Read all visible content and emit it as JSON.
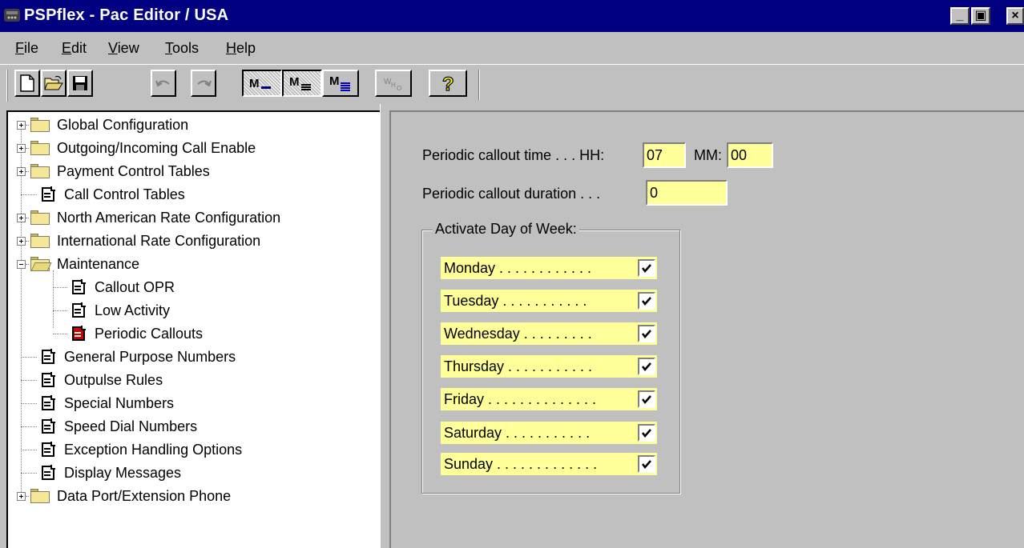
{
  "window": {
    "title": "PSPflex - Pac Editor / USA",
    "controls": {
      "minimize": "_",
      "maximize": "▣",
      "close": "×"
    }
  },
  "menu": {
    "items": [
      {
        "label": "File",
        "accel": "F",
        "rest": "ile"
      },
      {
        "label": "Edit",
        "accel": "E",
        "rest": "dit"
      },
      {
        "label": "View",
        "accel": "V",
        "rest": "iew"
      },
      {
        "label": "Tools",
        "accel": "T",
        "rest": "ools"
      },
      {
        "label": "Help",
        "accel": "H",
        "rest": "elp"
      }
    ]
  },
  "toolbar": {
    "buttons": [
      {
        "icon": "new-file-icon"
      },
      {
        "icon": "open-folder-icon"
      },
      {
        "icon": "save-disk-icon"
      },
      {
        "icon": "undo-icon",
        "disabled": true
      },
      {
        "icon": "redo-icon",
        "disabled": true
      },
      {
        "icon": "view-mode-1-icon",
        "pressed": true
      },
      {
        "icon": "view-mode-2-icon",
        "pressed": true
      },
      {
        "icon": "view-mode-3-icon"
      },
      {
        "icon": "who-icon",
        "disabled": true
      },
      {
        "icon": "help-question-icon"
      }
    ]
  },
  "tree": {
    "items": [
      {
        "label": "Global Configuration",
        "type": "folder",
        "expandable": true
      },
      {
        "label": "Outgoing/Incoming Call Enable",
        "type": "folder",
        "expandable": true
      },
      {
        "label": "Payment Control Tables",
        "type": "folder",
        "expandable": true
      },
      {
        "label": "Call Control Tables",
        "type": "doc"
      },
      {
        "label": "North American Rate Configuration",
        "type": "folder",
        "expandable": true
      },
      {
        "label": "International Rate Configuration",
        "type": "folder",
        "expandable": true
      },
      {
        "label": "Maintenance",
        "type": "folder-open",
        "expanded": true
      },
      {
        "label": "Callout OPR",
        "type": "doc",
        "child": true
      },
      {
        "label": "Low Activity",
        "type": "doc",
        "child": true
      },
      {
        "label": "Periodic Callouts",
        "type": "doc",
        "child": true,
        "selected": true
      },
      {
        "label": "General Purpose Numbers",
        "type": "doc"
      },
      {
        "label": "Outpulse Rules",
        "type": "doc"
      },
      {
        "label": "Special Numbers",
        "type": "doc"
      },
      {
        "label": "Speed Dial Numbers",
        "type": "doc"
      },
      {
        "label": "Exception Handling Options",
        "type": "doc"
      },
      {
        "label": "Display Messages",
        "type": "doc"
      },
      {
        "label": "Data Port/Extension Phone",
        "type": "folder",
        "expandable": true
      }
    ]
  },
  "form": {
    "callout_time_label": "Periodic callout time . . .  HH:",
    "hh_value": "07",
    "mm_label": "MM:",
    "mm_value": "00",
    "duration_label": "Periodic callout duration . . .",
    "duration_value": "0",
    "group_title": "Activate Day of Week:",
    "days": [
      {
        "label": "Monday . . . . . . . . . . . .",
        "checked": true
      },
      {
        "label": "Tuesday . . . . . . . . . . .",
        "checked": true
      },
      {
        "label": "Wednesday . . . . . . . . .",
        "checked": true
      },
      {
        "label": "Thursday . . . . . . . . . . .",
        "checked": true
      },
      {
        "label": "Friday . . . . . . . . . . . . . .",
        "checked": true
      },
      {
        "label": "Saturday . . . . . . . . . . .",
        "checked": true
      },
      {
        "label": "Sunday . . . . . . . . . . . . .",
        "checked": true
      }
    ]
  },
  "colors": {
    "titlebar": "#000080",
    "field_bg": "#ffff99",
    "face": "#c0c0c0",
    "selected_doc": "#cc0000"
  }
}
